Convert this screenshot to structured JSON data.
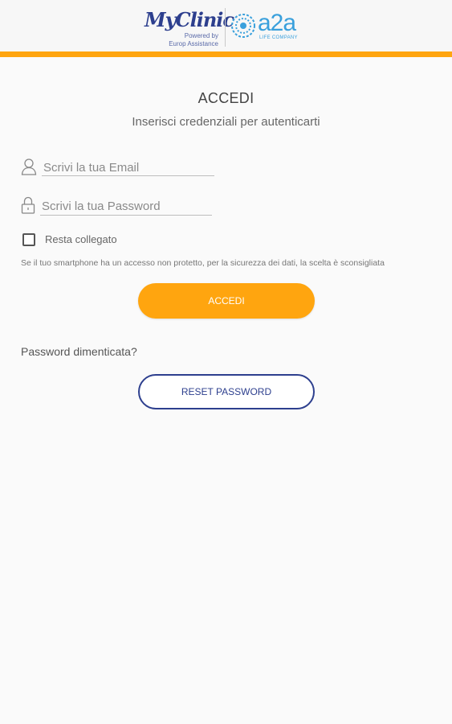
{
  "header": {
    "brand_name": "MyClinic",
    "powered_by": "Powered by",
    "powered_company": "Europ Assistance",
    "partner_logo": "a2a",
    "partner_tagline": "LIFE COMPANY",
    "accent_color": "#ffa50f"
  },
  "login": {
    "title": "ACCEDI",
    "subtitle": "Inserisci credenziali per autenticarti",
    "email": {
      "value": "",
      "placeholder": "Scrivi la tua Email",
      "icon": "user-icon"
    },
    "password": {
      "value": "",
      "placeholder": "Scrivi la tua Password",
      "icon": "lock-icon"
    },
    "remember": {
      "label": "Resta collegato",
      "checked": false
    },
    "notice": "Se il tuo smartphone ha un accesso non protetto, per la sicurezza dei dati, la scelta è sconsigliata",
    "submit_label": "ACCEDI",
    "forgot_label": "Password dimenticata?",
    "reset_label": "RESET PASSWORD"
  },
  "colors": {
    "primary_button": "#ffa50f",
    "secondary_border": "#2d3f8e",
    "brand_blue": "#2d3f8e",
    "partner_blue": "#3aa0dc"
  }
}
